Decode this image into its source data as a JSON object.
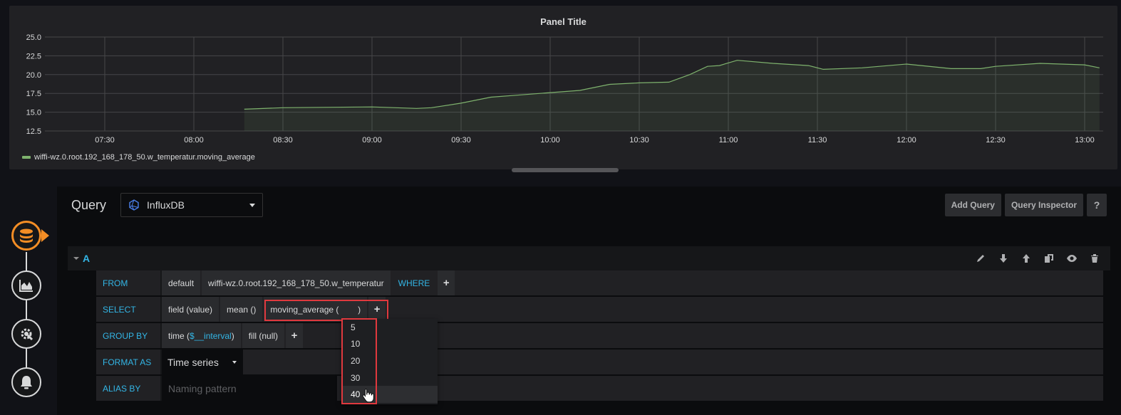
{
  "panel": {
    "title": "Panel Title",
    "legend": "wiffi-wz.0.root.192_168_178_50.w_temperatur.moving_average"
  },
  "chart_data": {
    "type": "area",
    "title": "Panel Title",
    "xlabel": "",
    "ylabel": "",
    "ylim": [
      12.5,
      25.0
    ],
    "xlim": [
      "07:05",
      "13:10"
    ],
    "yticks": [
      "25.0",
      "22.5",
      "20.0",
      "17.5",
      "15.0",
      "12.5"
    ],
    "xticks": [
      "07:30",
      "08:00",
      "08:30",
      "09:00",
      "09:30",
      "10:00",
      "10:30",
      "11:00",
      "11:30",
      "12:00",
      "12:30",
      "13:00"
    ],
    "grid": true,
    "legend_position": "bottom-left",
    "series": [
      {
        "name": "wiffi-wz.0.root.192_168_178_50.w_temperatur.moving_average",
        "color": "#7eb26d",
        "x": [
          "08:17",
          "08:30",
          "09:00",
          "09:15",
          "09:20",
          "09:30",
          "09:40",
          "09:50",
          "10:00",
          "10:10",
          "10:20",
          "10:30",
          "10:40",
          "10:47",
          "10:53",
          "10:57",
          "11:03",
          "11:15",
          "11:27",
          "11:32",
          "11:45",
          "12:00",
          "12:15",
          "12:25",
          "12:30",
          "12:45",
          "13:00",
          "13:05"
        ],
        "values": [
          15.4,
          15.6,
          15.7,
          15.5,
          15.6,
          16.2,
          17.0,
          17.3,
          17.6,
          17.9,
          18.7,
          18.9,
          19.0,
          20.0,
          21.1,
          21.2,
          21.9,
          21.5,
          21.2,
          20.7,
          20.9,
          21.4,
          20.8,
          20.8,
          21.1,
          21.5,
          21.3,
          20.9
        ]
      }
    ]
  },
  "editor": {
    "title": "Query",
    "datasource": "InfluxDB",
    "buttons": {
      "add_query": "Add Query",
      "query_inspector": "Query Inspector",
      "help": "?"
    },
    "query": {
      "ref_id": "A",
      "from": {
        "label": "FROM",
        "policy": "default",
        "measurement": "wiffi-wz.0.root.192_168_178_50.w_temperatur",
        "where": "WHERE"
      },
      "select": {
        "label": "SELECT",
        "field": "field (value)",
        "aggregate": "mean ()",
        "transform": "moving_average (        )"
      },
      "group_by": {
        "label": "GROUP BY",
        "time_prefix": "time (",
        "time_var": "$__interval",
        "time_suffix": ")",
        "fill": "fill (null)"
      },
      "format_as": {
        "label": "FORMAT AS",
        "value": "Time series"
      },
      "alias_by": {
        "label": "ALIAS BY",
        "placeholder": "Naming pattern",
        "value": ""
      },
      "plus": "+"
    },
    "dropdown_options": [
      "5",
      "10",
      "20",
      "30",
      "40"
    ],
    "dropdown_hovered": "40"
  },
  "colors": {
    "accent": "#33b5e5",
    "series": "#7eb26d",
    "highlight": "#e0393e",
    "active_step": "#f38d25"
  }
}
